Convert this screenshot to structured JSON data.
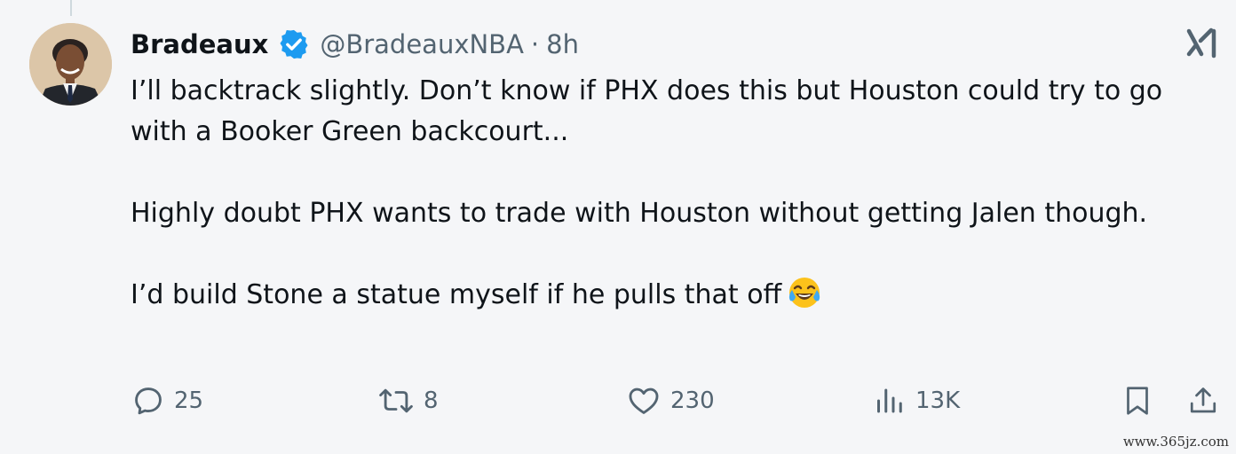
{
  "author": {
    "display_name": "Bradeaux",
    "handle": "@BradeauxNBA",
    "separator": "·",
    "time": "8h"
  },
  "tweet": {
    "paragraphs": [
      "I’ll backtrack slightly. Don’t know if PHX does this but Houston could try to go with a Booker Green backcourt...",
      "Highly doubt PHX wants to trade with Houston without getting Jalen though.",
      "I’d build Stone a statue myself if he pulls that off"
    ],
    "emoji": "face-with-tears-of-joy"
  },
  "actions": {
    "replies": "25",
    "reposts": "8",
    "likes": "230",
    "views": "13K"
  },
  "watermark": "www.365jz.com",
  "colors": {
    "background": "#f5f6f8",
    "text": "#0f1419",
    "muted": "#536471",
    "verified": "#1d9bf0"
  }
}
